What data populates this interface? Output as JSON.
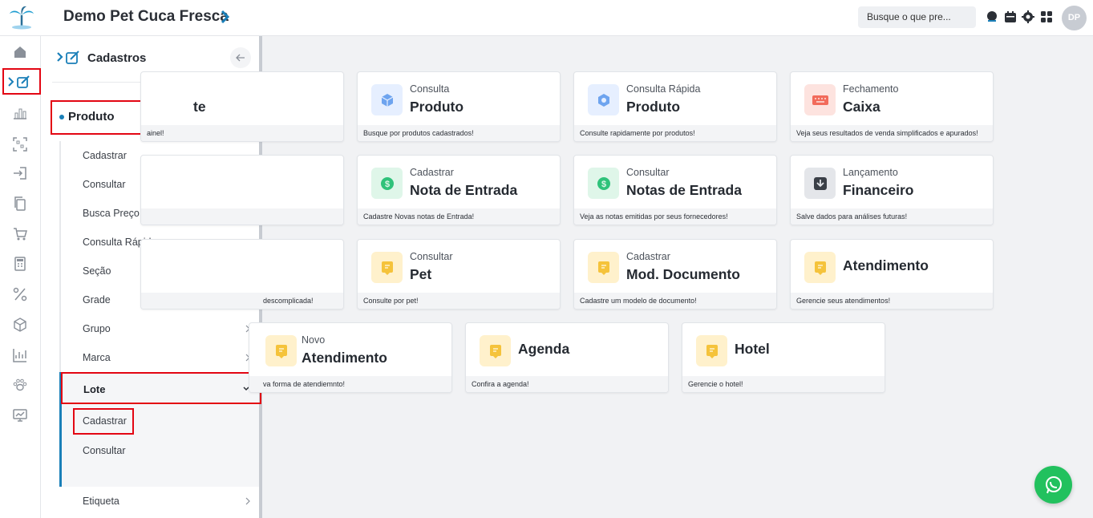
{
  "header": {
    "company": "Demo Pet Cuca Fresca",
    "search_placeholder": "Busque o que pre...",
    "avatar_initials": "DP"
  },
  "rail": {
    "icons": [
      "home-icon",
      "edit-register-icon",
      "chart-icon",
      "scan-icon",
      "login-icon",
      "copy-icon",
      "cart-icon",
      "calculator-icon",
      "percent-icon",
      "box-icon",
      "analytics-icon",
      "paw-icon",
      "presentation-icon"
    ]
  },
  "panel": {
    "title": "Cadastros",
    "section": "Produto",
    "items": [
      {
        "label": "Cadastrar"
      },
      {
        "label": "Consultar"
      },
      {
        "label": "Busca Preço"
      },
      {
        "label": "Consulta Rápida"
      },
      {
        "label": "Seção"
      },
      {
        "label": "Grade"
      },
      {
        "label": "Grupo"
      },
      {
        "label": "Marca"
      }
    ],
    "lote": {
      "label": "Lote",
      "items": [
        {
          "label": "Cadastrar"
        },
        {
          "label": "Consultar"
        }
      ]
    },
    "etiqueta": "Etiqueta"
  },
  "cards": [
    {
      "sub": "",
      "title": "te",
      "foot": "ainel!",
      "color": "#4b8de8"
    },
    {
      "sub": "Consulta",
      "title": "Produto",
      "foot": "Busque por produtos cadastrados!",
      "color": "#4b8de8"
    },
    {
      "sub": "Consulta Rápida",
      "title": "Produto",
      "foot": "Consulte rapidamente por produtos!",
      "color": "#4b8de8"
    },
    {
      "sub": "Fechamento",
      "title": "Caixa",
      "foot": "Veja seus resultados de venda simplificados e apurados!",
      "color": "#f26b5b"
    },
    {
      "sub": "",
      "title": "",
      "foot": "",
      "color": ""
    },
    {
      "sub": "Cadastrar",
      "title": "Nota de Entrada",
      "foot": "Cadastre Novas notas de Entrada!",
      "color": "#2fc27a"
    },
    {
      "sub": "Consultar",
      "title": "Notas de Entrada",
      "foot": "Veja as notas emitidas por seus fornecedores!",
      "color": "#2fc27a"
    },
    {
      "sub": "Lançamento",
      "title": "Financeiro",
      "foot": "Salve dados para análises futuras!",
      "color": "#3a3f47"
    },
    {
      "sub": "",
      "title": "",
      "foot": "descomplicada!",
      "color": ""
    },
    {
      "sub": "Consultar",
      "title": "Pet",
      "foot": "Consulte por pet!",
      "color": "#f5c33b"
    },
    {
      "sub": "Cadastrar",
      "title": "Mod. Documento",
      "foot": "Cadastre um modelo de documento!",
      "color": "#f5c33b"
    },
    {
      "sub": "",
      "title": "Atendimento",
      "foot": "Gerencie seus atendimentos!",
      "color": "#f5c33b"
    },
    {
      "sub": "Novo",
      "title": "Atendimento",
      "foot": "va forma de atendiemnto!",
      "color": "#f5c33b"
    },
    {
      "sub": "",
      "title": "Agenda",
      "foot": "Confira a agenda!",
      "color": "#f5c33b"
    },
    {
      "sub": "",
      "title": "Hotel",
      "foot": "Gerencie o hotel!",
      "color": "#f5c33b"
    }
  ]
}
